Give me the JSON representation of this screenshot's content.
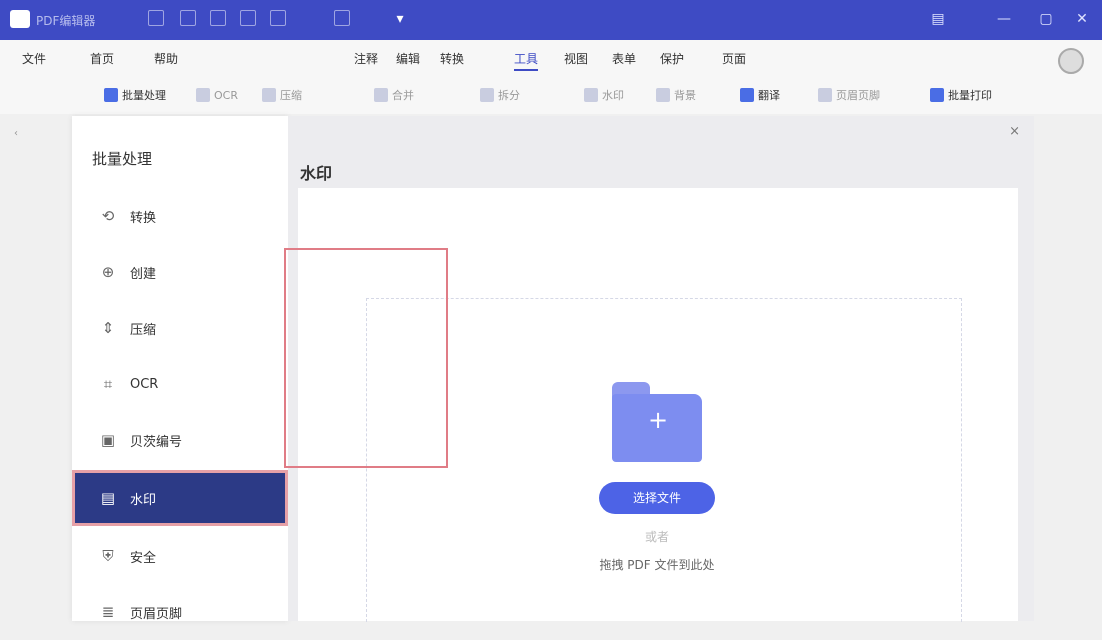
{
  "titlebar": {
    "app_title": "PDF编辑器",
    "window_controls": {
      "minimize": "—",
      "maximize": "▢",
      "close": "✕"
    }
  },
  "menu": {
    "file": "文件",
    "items": [
      "首页",
      "帮助"
    ],
    "tabs": [
      "注释",
      "编辑",
      "转换",
      "工具",
      "视图",
      "表单",
      "保护",
      "页面"
    ],
    "active_tab": "工具"
  },
  "toolbar": {
    "batch_process": "批量处理",
    "tools": [
      "OCR",
      "压缩",
      "合并",
      "拆分",
      "水印",
      "背景",
      "页眉页脚"
    ],
    "translate": "翻译",
    "batch_print": "批量打印"
  },
  "side_panel": {
    "title": "批量处理",
    "items": [
      {
        "label": "转换",
        "icon": "convert-icon"
      },
      {
        "label": "创建",
        "icon": "create-icon"
      },
      {
        "label": "压缩",
        "icon": "compress-icon"
      },
      {
        "label": "OCR",
        "icon": "ocr-icon"
      },
      {
        "label": "贝茨编号",
        "icon": "bates-icon"
      },
      {
        "label": "水印",
        "icon": "watermark-icon",
        "selected": true
      },
      {
        "label": "安全",
        "icon": "security-icon"
      },
      {
        "label": "页眉页脚",
        "icon": "header-footer-icon"
      }
    ]
  },
  "main": {
    "title": "水印",
    "close": "×",
    "select_button": "选择文件",
    "or_text": "或者",
    "drag_hint": "拖拽 PDF 文件到此处"
  },
  "colors": {
    "titlebar": "#3e4bc4",
    "accent": "#4d63e6",
    "selected_item": "#2c3a86",
    "highlight_border": "#e07c86"
  }
}
